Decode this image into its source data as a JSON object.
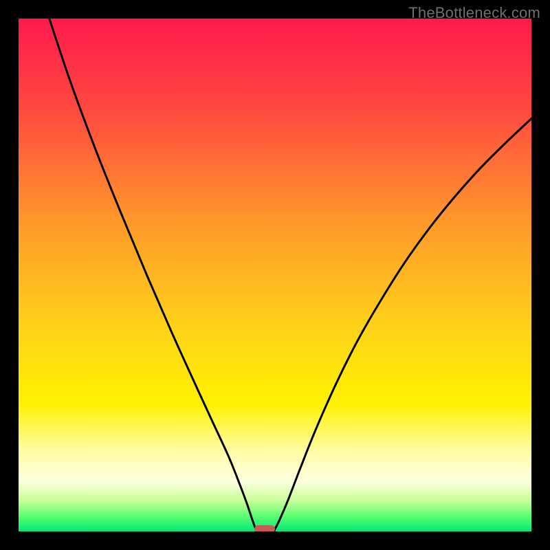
{
  "watermark": "TheBottleneck.com",
  "chart_data": {
    "type": "line",
    "title": "",
    "xlabel": "",
    "ylabel": "",
    "xlim": [
      0,
      100
    ],
    "ylim": [
      0,
      100
    ],
    "background_gradient_stops": [
      {
        "pct": 0,
        "color": "#ff1a4d"
      },
      {
        "pct": 18,
        "color": "#ff4a40"
      },
      {
        "pct": 40,
        "color": "#ff9a2a"
      },
      {
        "pct": 60,
        "color": "#ffd21a"
      },
      {
        "pct": 75,
        "color": "#fff200"
      },
      {
        "pct": 84,
        "color": "#fffca0"
      },
      {
        "pct": 90,
        "color": "#ffffe0"
      },
      {
        "pct": 94,
        "color": "#c8ff9a"
      },
      {
        "pct": 97,
        "color": "#5dff70"
      },
      {
        "pct": 100,
        "color": "#00e878"
      }
    ],
    "curve_points": [
      {
        "x": 6.0,
        "y": 100.0
      },
      {
        "x": 10.0,
        "y": 88.0
      },
      {
        "x": 15.0,
        "y": 74.5
      },
      {
        "x": 20.0,
        "y": 62.0
      },
      {
        "x": 25.0,
        "y": 50.0
      },
      {
        "x": 30.0,
        "y": 38.5
      },
      {
        "x": 35.0,
        "y": 27.5
      },
      {
        "x": 38.0,
        "y": 21.0
      },
      {
        "x": 41.0,
        "y": 14.5
      },
      {
        "x": 43.0,
        "y": 9.5
      },
      {
        "x": 44.5,
        "y": 5.5
      },
      {
        "x": 45.5,
        "y": 2.5
      },
      {
        "x": 46.2,
        "y": 0.6
      },
      {
        "x": 46.7,
        "y": 0.0
      },
      {
        "x": 49.5,
        "y": 0.0
      },
      {
        "x": 50.0,
        "y": 0.5
      },
      {
        "x": 51.0,
        "y": 2.5
      },
      {
        "x": 52.5,
        "y": 6.0
      },
      {
        "x": 55.0,
        "y": 12.5
      },
      {
        "x": 58.0,
        "y": 20.0
      },
      {
        "x": 62.0,
        "y": 29.0
      },
      {
        "x": 66.0,
        "y": 37.0
      },
      {
        "x": 70.0,
        "y": 44.0
      },
      {
        "x": 75.0,
        "y": 52.0
      },
      {
        "x": 80.0,
        "y": 59.0
      },
      {
        "x": 85.0,
        "y": 65.2
      },
      {
        "x": 90.0,
        "y": 70.8
      },
      {
        "x": 95.0,
        "y": 75.8
      },
      {
        "x": 100.0,
        "y": 80.5
      }
    ],
    "marker": {
      "x": 48.0,
      "y": 0.0,
      "color": "#c85a5a"
    }
  }
}
